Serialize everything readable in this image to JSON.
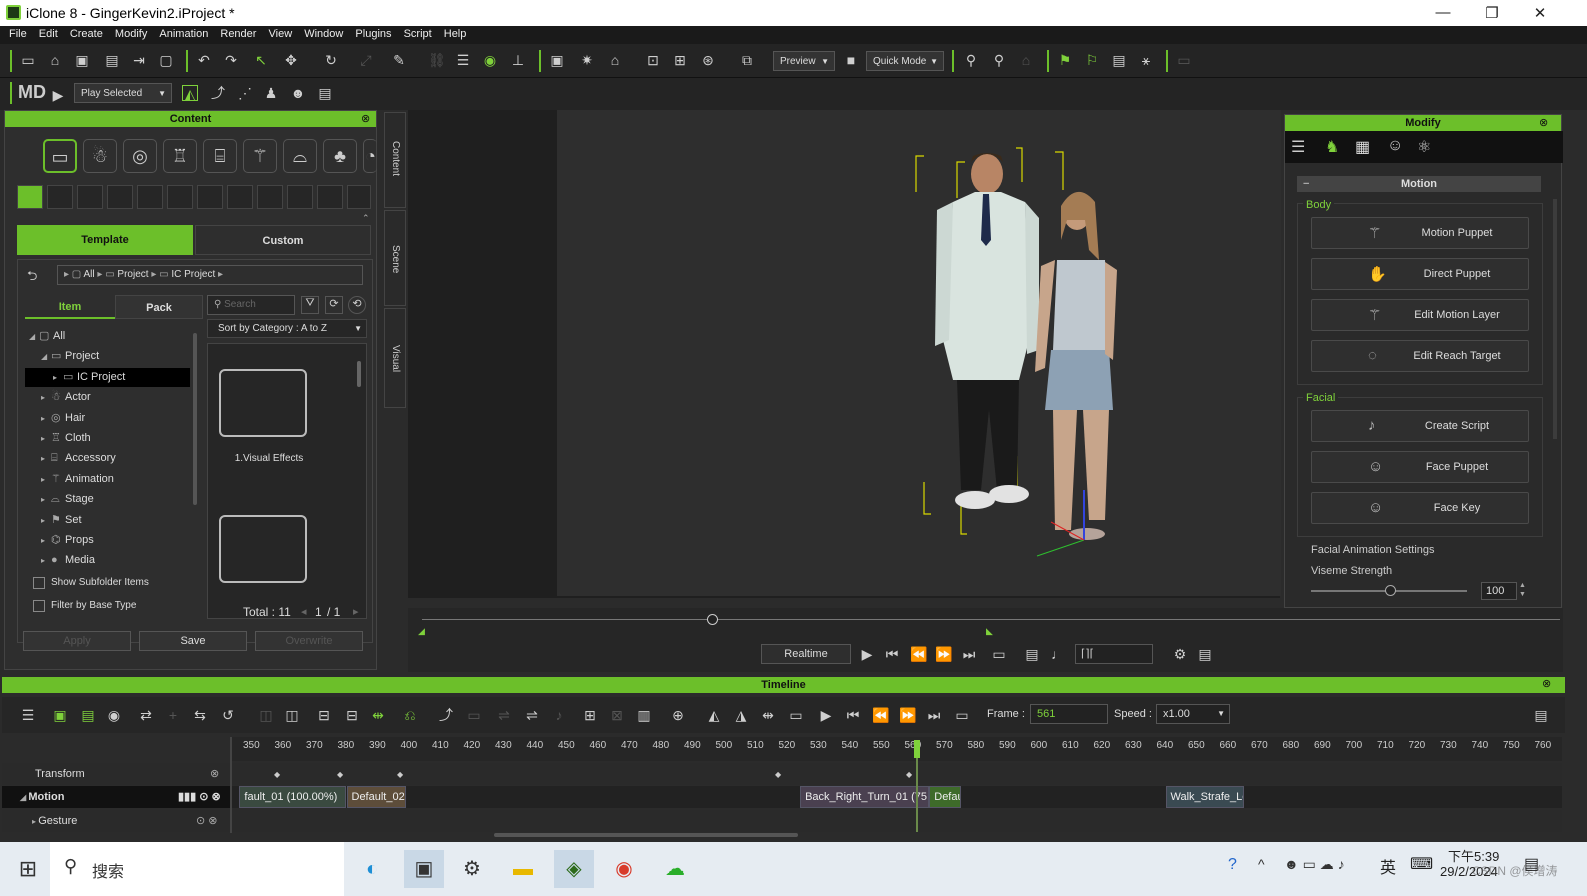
{
  "window": {
    "title": "iClone 8 - GingerKevin2.iProject *",
    "controls": {
      "minimize": "—",
      "restore": "❐",
      "close": "✕"
    }
  },
  "menu": [
    "File",
    "Edit",
    "Create",
    "Modify",
    "Animation",
    "Render",
    "View",
    "Window",
    "Plugins",
    "Script",
    "Help"
  ],
  "toolbar": {
    "preview_label": "Preview",
    "quick_mode_label": "Quick Mode",
    "play_selected_label": "Play Selected",
    "md_label": "MD"
  },
  "content": {
    "title": "Content",
    "side_tabs": [
      "Content",
      "Scene",
      "Visual"
    ],
    "tabs": {
      "template": "Template",
      "custom": "Custom"
    },
    "breadcrumb": [
      "All",
      "Project",
      "IC Project"
    ],
    "subtabs": {
      "item": "Item",
      "pack": "Pack"
    },
    "search_placeholder": "Search",
    "sort_label": "Sort by Category : A to Z",
    "tree": [
      {
        "label": "All",
        "level": 0,
        "expanded": true
      },
      {
        "label": "Project",
        "level": 1,
        "expanded": true
      },
      {
        "label": "IC Project",
        "level": 2,
        "selected": true
      },
      {
        "label": "Actor",
        "level": 1
      },
      {
        "label": "Hair",
        "level": 1
      },
      {
        "label": "Cloth",
        "level": 1
      },
      {
        "label": "Accessory",
        "level": 1
      },
      {
        "label": "Animation",
        "level": 1
      },
      {
        "label": "Stage",
        "level": 1
      },
      {
        "label": "Set",
        "level": 1
      },
      {
        "label": "Props",
        "level": 1
      },
      {
        "label": "Media",
        "level": 1
      }
    ],
    "items": [
      "1.Visual Effects",
      ""
    ],
    "show_subfolder": "Show Subfolder Items",
    "filter_base": "Filter by Base Type",
    "total_label": "Total : 11",
    "page": "1",
    "pages": "/ 1",
    "buttons": {
      "apply": "Apply",
      "save": "Save",
      "overwrite": "Overwrite"
    }
  },
  "modify": {
    "title": "Modify",
    "section": "Motion",
    "body_group": "Body",
    "facial_group": "Facial",
    "body_buttons": [
      "Motion Puppet",
      "Direct Puppet",
      "Edit Motion Layer",
      "Edit Reach Target"
    ],
    "facial_buttons": [
      "Create Script",
      "Face Puppet",
      "Face Key"
    ],
    "facial_settings": "Facial Animation Settings",
    "viseme_label": "Viseme Strength",
    "viseme_value": "100"
  },
  "playbar": {
    "realtime_label": "Realtime",
    "scrub_position": 0.255
  },
  "timeline": {
    "title": "Timeline",
    "frame_label": "Frame :",
    "frame_value": "561",
    "speed_label": "Speed :",
    "speed_value": "x1.00",
    "ruler_ticks": [
      "350",
      "360",
      "370",
      "380",
      "390",
      "400",
      "410",
      "420",
      "430",
      "440",
      "450",
      "460",
      "470",
      "480",
      "490",
      "500",
      "510",
      "520",
      "530",
      "540",
      "550",
      "560",
      "570",
      "580",
      "590",
      "600",
      "610",
      "620",
      "630",
      "640",
      "650",
      "660",
      "670",
      "680",
      "690",
      "700",
      "710",
      "720",
      "730",
      "740",
      "750",
      "760"
    ],
    "tracks": [
      "Transform",
      "Motion",
      "Gesture"
    ],
    "clips": [
      {
        "label": "fault_01 (100.00%)",
        "start": 346,
        "end": 380
      },
      {
        "label": "Default_02 (",
        "start": 380,
        "end": 399
      },
      {
        "label": "Back_Right_Turn_01 (75.61%",
        "start": 524,
        "end": 565
      },
      {
        "label": "Defau",
        "start": 565,
        "end": 575
      },
      {
        "label": "Walk_Strafe_Left",
        "start": 640,
        "end": 665
      }
    ]
  },
  "taskbar": {
    "search_placeholder": "搜索",
    "time": "下午5:39",
    "date": "29/2/2024",
    "ime": "英",
    "watermark": "CSDN @侯增涛"
  }
}
